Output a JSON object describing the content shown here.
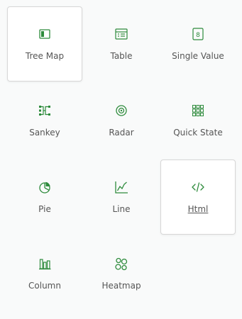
{
  "accent_color": "#2e8b3c",
  "tiles": [
    {
      "label": "Tree Map",
      "icon": "tree-map-icon",
      "highlighted": true
    },
    {
      "label": "Table",
      "icon": "table-icon",
      "highlighted": false
    },
    {
      "label": "Single Value",
      "icon": "single-value-icon",
      "highlighted": false
    },
    {
      "label": "Sankey",
      "icon": "sankey-icon",
      "highlighted": false
    },
    {
      "label": "Radar",
      "icon": "radar-icon",
      "highlighted": false
    },
    {
      "label": "Quick State",
      "icon": "quick-state-icon",
      "highlighted": false
    },
    {
      "label": "Pie",
      "icon": "pie-icon",
      "highlighted": false
    },
    {
      "label": "Line",
      "icon": "line-icon",
      "highlighted": false
    },
    {
      "label": "Html",
      "icon": "html-icon",
      "highlighted": true,
      "underlined": true
    },
    {
      "label": "Column",
      "icon": "column-icon",
      "highlighted": false
    },
    {
      "label": "Heatmap",
      "icon": "heatmap-icon",
      "highlighted": false
    }
  ]
}
